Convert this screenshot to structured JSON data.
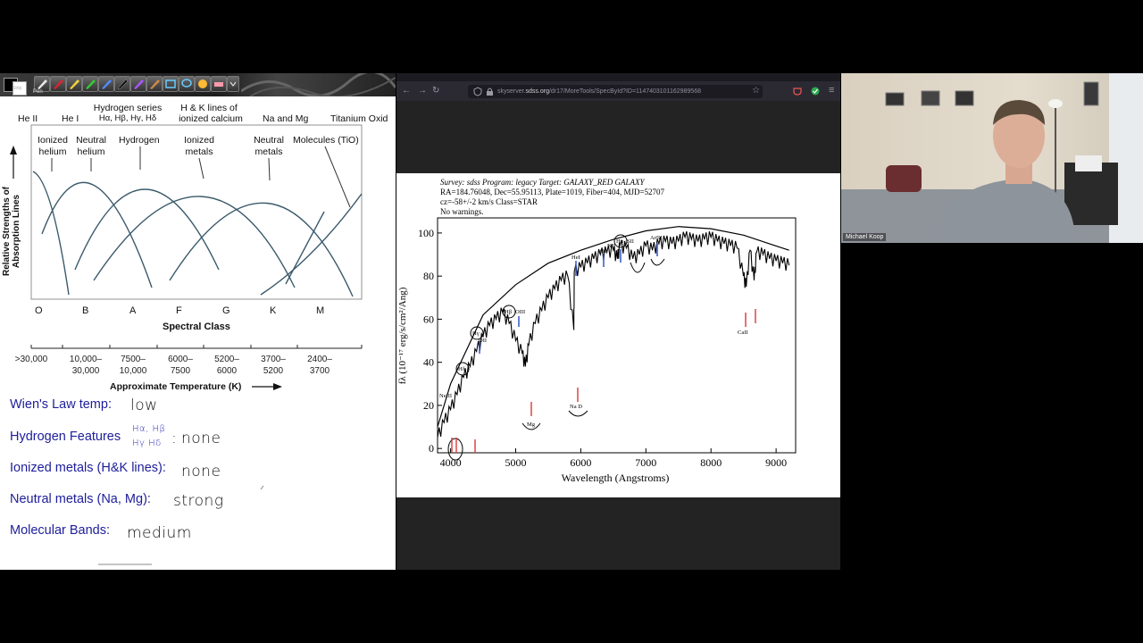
{
  "notes": {
    "toolbar": {
      "strip_label": "Strip",
      "pen_label": "Pen"
    },
    "diagram": {
      "top_labels": {
        "he2": "He II",
        "he1": "He I",
        "hseries_line1": "Hydrogen series",
        "hseries_line2": "Hα, Hβ, Hγ, Hδ",
        "hk_line1": "H & K lines of",
        "hk_line2": "ionized calcium",
        "namg": "Na and Mg",
        "tio": "Titanium Oxid"
      },
      "curve_labels": {
        "ionized_helium": "Ionized helium",
        "neutral_helium": "Neutral helium",
        "hydrogen": "Hydrogen",
        "ionized_metals": "Ionized metals",
        "neutral_metals": "Neutral metals",
        "molecules": "Molecules (TiO)"
      },
      "ylabel_line1": "Relative Strengths of",
      "ylabel_line2": "Absorption Lines",
      "classes": [
        "O",
        "B",
        "A",
        "F",
        "G",
        "K",
        "M"
      ],
      "xlabel": "Spectral Class",
      "temperatures": [
        ">30,000",
        "10,000–\n30,000",
        "7500–\n10,000",
        "6000–\n7500",
        "5200–\n6000",
        "3700–\n5200",
        "2400–\n3700"
      ],
      "temp_label": "Approximate Temperature (K)"
    },
    "lines": {
      "wien_label": "Wien's Law temp:",
      "wien_value": "low",
      "hydrogen_label": "Hydrogen Features",
      "hydrogen_hw_line1": "Hα, Hβ",
      "hydrogen_hw_line2": "Hγ Hδ",
      "hydrogen_value": "none",
      "ionized_label": "Ionized metals (H&K lines):",
      "ionized_value": "none",
      "neutral_label": "Neutral metals (Na, Mg):",
      "neutral_value": "strong",
      "molecular_label": "Molecular Bands:",
      "molecular_value": "medium"
    }
  },
  "browser": {
    "url_prefix": "skyserver.",
    "url_domain": "sdss.org",
    "url_path": "/dr17/MoreTools/SpecById?ID=1147403101162989568",
    "spectrum": {
      "header_line1": "Survey: sdss Program: legacy Target: GALAXY_RED GALAXY",
      "header_line2": "RA=184.76048, Dec=55.95113, Plate=1019, Fiber=404, MJD=52707",
      "header_line3": "cz=-58+/-2 km/s Class=STAR",
      "header_line4": "No warnings.",
      "ylabel": "fλ (10⁻¹⁷ erg/s/cm²/Ang)",
      "xlabel": "Wavelength (Angstroms)",
      "annotations": {
        "hei": "HeI",
        "oi": "OI",
        "nii": "NII",
        "ha": "Hα",
        "sii": "SII",
        "ariii": "ArIII",
        "hb": "Hβ",
        "oiii": "OIII",
        "hg": "Hγ",
        "oii": "OII",
        "hd": "Hδ",
        "neiii": "NeIII",
        "mg": "Mg",
        "nad": "Na D",
        "caii": "CaII"
      }
    }
  },
  "webcam": {
    "name": "Michael Koop"
  },
  "chart_data": {
    "type": "line",
    "title": "",
    "xlabel": "Wavelength (Angstroms)",
    "ylabel": "fλ (10⁻¹⁷ erg/s/cm²/Ang)",
    "xlim": [
      3800,
      9300
    ],
    "ylim": [
      -2,
      107
    ],
    "x_ticks": [
      4000,
      5000,
      6000,
      7000,
      8000,
      9000
    ],
    "y_ticks": [
      0,
      20,
      40,
      60,
      80,
      100
    ],
    "series": [
      {
        "x": [
          3800,
          3900,
          4000,
          4100,
          4200,
          4300,
          4400,
          4500,
          4600,
          4700,
          4800,
          4900,
          5000,
          5100,
          5150,
          5200,
          5300,
          5400,
          5500,
          5600,
          5700,
          5800,
          5893,
          5900,
          6000,
          6100,
          6200,
          6300,
          6400,
          6500,
          6563,
          6600,
          6700,
          6800,
          6900,
          7000,
          7100,
          7200,
          7300,
          7400,
          7500,
          7600,
          7700,
          7800,
          7900,
          8000,
          8100,
          8200,
          8300,
          8400,
          8498,
          8542,
          8600,
          8662,
          8700,
          8800,
          8900,
          9000,
          9100,
          9200
        ],
        "y": [
          5,
          12,
          18,
          25,
          33,
          38,
          45,
          52,
          57,
          60,
          63,
          58,
          50,
          44,
          38,
          48,
          58,
          64,
          70,
          74,
          78,
          80,
          55,
          82,
          84,
          86,
          88,
          90,
          91,
          92,
          88,
          94,
          93,
          88,
          90,
          94,
          92,
          95,
          96,
          95,
          96,
          98,
          97,
          96,
          97,
          98,
          96,
          95,
          94,
          93,
          80,
          75,
          92,
          78,
          91,
          90,
          88,
          87,
          86,
          85
        ]
      },
      {
        "x": [
          3800,
          4000,
          4500,
          5000,
          5500,
          6000,
          6500,
          7000,
          7500,
          8000,
          8500,
          9000,
          9200
        ],
        "y": [
          10,
          30,
          62,
          76,
          86,
          92,
          97,
          101,
          103,
          102,
          99,
          94,
          92
        ]
      }
    ]
  }
}
